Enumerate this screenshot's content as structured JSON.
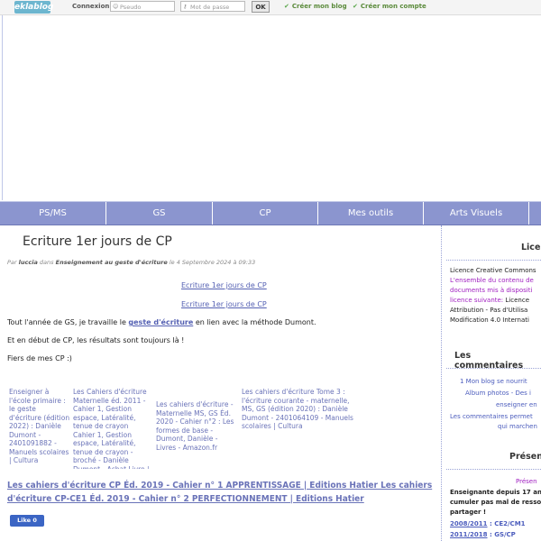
{
  "topbar": {
    "logo": "eklablog",
    "connexion_label": "Connexion :",
    "pseudo_placeholder": "Pseudo",
    "password_placeholder": "Mot de passe",
    "ok_label": "OK",
    "create_blog": "Créer mon blog",
    "create_account": "Créer mon compte"
  },
  "nav": {
    "items": [
      "PS/MS",
      "GS",
      "CP",
      "Mes outils",
      "Arts Visuels"
    ]
  },
  "post": {
    "title": "Ecriture 1er jours de CP",
    "meta_par": "Par",
    "meta_author": "luccia",
    "meta_dans": "dans",
    "meta_category": "Enseignement au geste d'écriture",
    "meta_date": "le 4 Septembre 2024 à 09:33",
    "link1": "Ecriture 1er jours de CP",
    "link2": "Ecriture 1er jours de CP",
    "para1_before": "Tout l'année de GS, je travaille le",
    "para1_link": "geste d'écriture",
    "para1_after": "en lien avec la méthode Dumont.",
    "para2": "Et en début de CP, les résultats sont toujours là !",
    "para3": "Fiers de mes CP :)",
    "cards": [
      "Enseigner à l'école primaire : le geste d'écriture (édition 2022) : Danièle  Dumont - 2401091882 - Manuels scolaires | Cultura",
      "Les Cahiers d'écriture Maternelle éd. 2011 - Cahier 1, Gestion espace,  Latéralité, tenue de crayon Cahier 1, Gestion espace, Latéralité, tenue de crayon - broché - Danièle Dumont - Achat Livre | fnac",
      "Les cahiers d'écriture - Maternelle MS, GS Éd. 2020 - Cahier n°2 : Les  formes de base - Dumont, Danièle - Livres - Amazon.fr",
      "Les cahiers d'écriture Tome 3 : l'écriture courante - maternelle, MS, GS  (édition 2020) : Danièle Dumont - 2401064109 - Manuels scolaires | Cultura"
    ],
    "big_links": "Les cahiers d'écriture CP Éd. 2019 - Cahier n° 1 APPRENTISSAGE | Editions Hatier    Les cahiers d'écriture CP-CE1 Éd. 2019 - Cahier n° 2 PERFECTIONNEMENT | Editions Hatier",
    "fb_like": "Like 0"
  },
  "sidebar": {
    "licence_heading": "Lice",
    "licence_line1": "Licence Creative Commons",
    "licence_line2": "L'ensemble du contenu de",
    "licence_line3": "documents mis à dispositi",
    "licence_line4": "licence suivante:",
    "licence_line4b": "Licence",
    "licence_line5": "Attribution - Pas d'Utilisa",
    "licence_line6": "Modification 4.0 Internati",
    "comments_heading": "Les commentaires",
    "comments_line1": "1 Mon blog se nourrit",
    "comments_line2": "Album photos - Des i",
    "comments_line3": "enseigner en",
    "comments_line4": "Les commentaires permet",
    "comments_line5": "qui marchen",
    "presentation_heading": "Présen",
    "pres_line1": "Présen",
    "pres_line2": "Enseignante depuis 17 an",
    "pres_line3": "cumuler pas mal de resso",
    "pres_line4": "partager !",
    "pres_line5_a": "2008/2011",
    "pres_line5_b": ": CE2/CM1",
    "pres_line6_a": "2011/2018",
    "pres_line6_b": ": GS/CP"
  }
}
